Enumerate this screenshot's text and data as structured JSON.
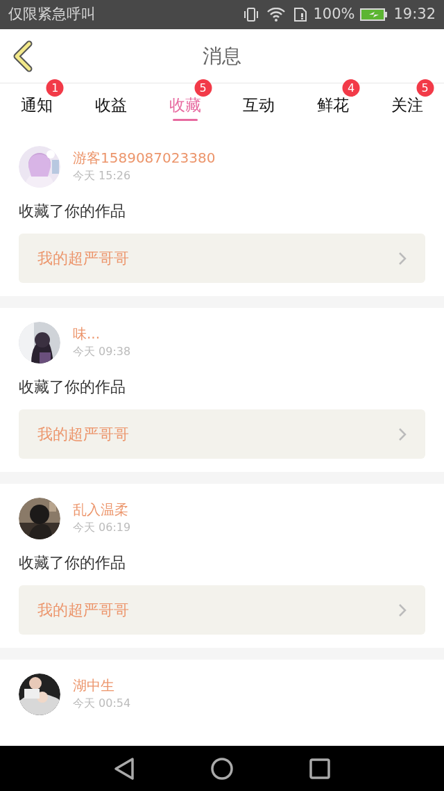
{
  "status_bar": {
    "carrier": "仅限紧急呼叫",
    "battery": "100%",
    "time": "19:32"
  },
  "header": {
    "title": "消息"
  },
  "tabs": [
    {
      "label": "通知",
      "badge": "1",
      "selected": false
    },
    {
      "label": "收益",
      "selected": false
    },
    {
      "label": "收藏",
      "badge": "5",
      "selected": true
    },
    {
      "label": "互动",
      "selected": false
    },
    {
      "label": "鲜花",
      "badge": "4",
      "selected": false
    },
    {
      "label": "关注",
      "badge": "5",
      "selected": false
    }
  ],
  "messages": [
    {
      "user": "游客1589087023380",
      "time": "今天 15:26",
      "text": "收藏了你的作品",
      "work": "我的超严哥哥"
    },
    {
      "user": "味...",
      "time": "今天 09:38",
      "text": "收藏了你的作品",
      "work": "我的超严哥哥"
    },
    {
      "user": "乱入温柔",
      "time": "今天 06:19",
      "text": "收藏了你的作品",
      "work": "我的超严哥哥"
    },
    {
      "user": "湖中生",
      "time": "今天 00:54"
    }
  ]
}
